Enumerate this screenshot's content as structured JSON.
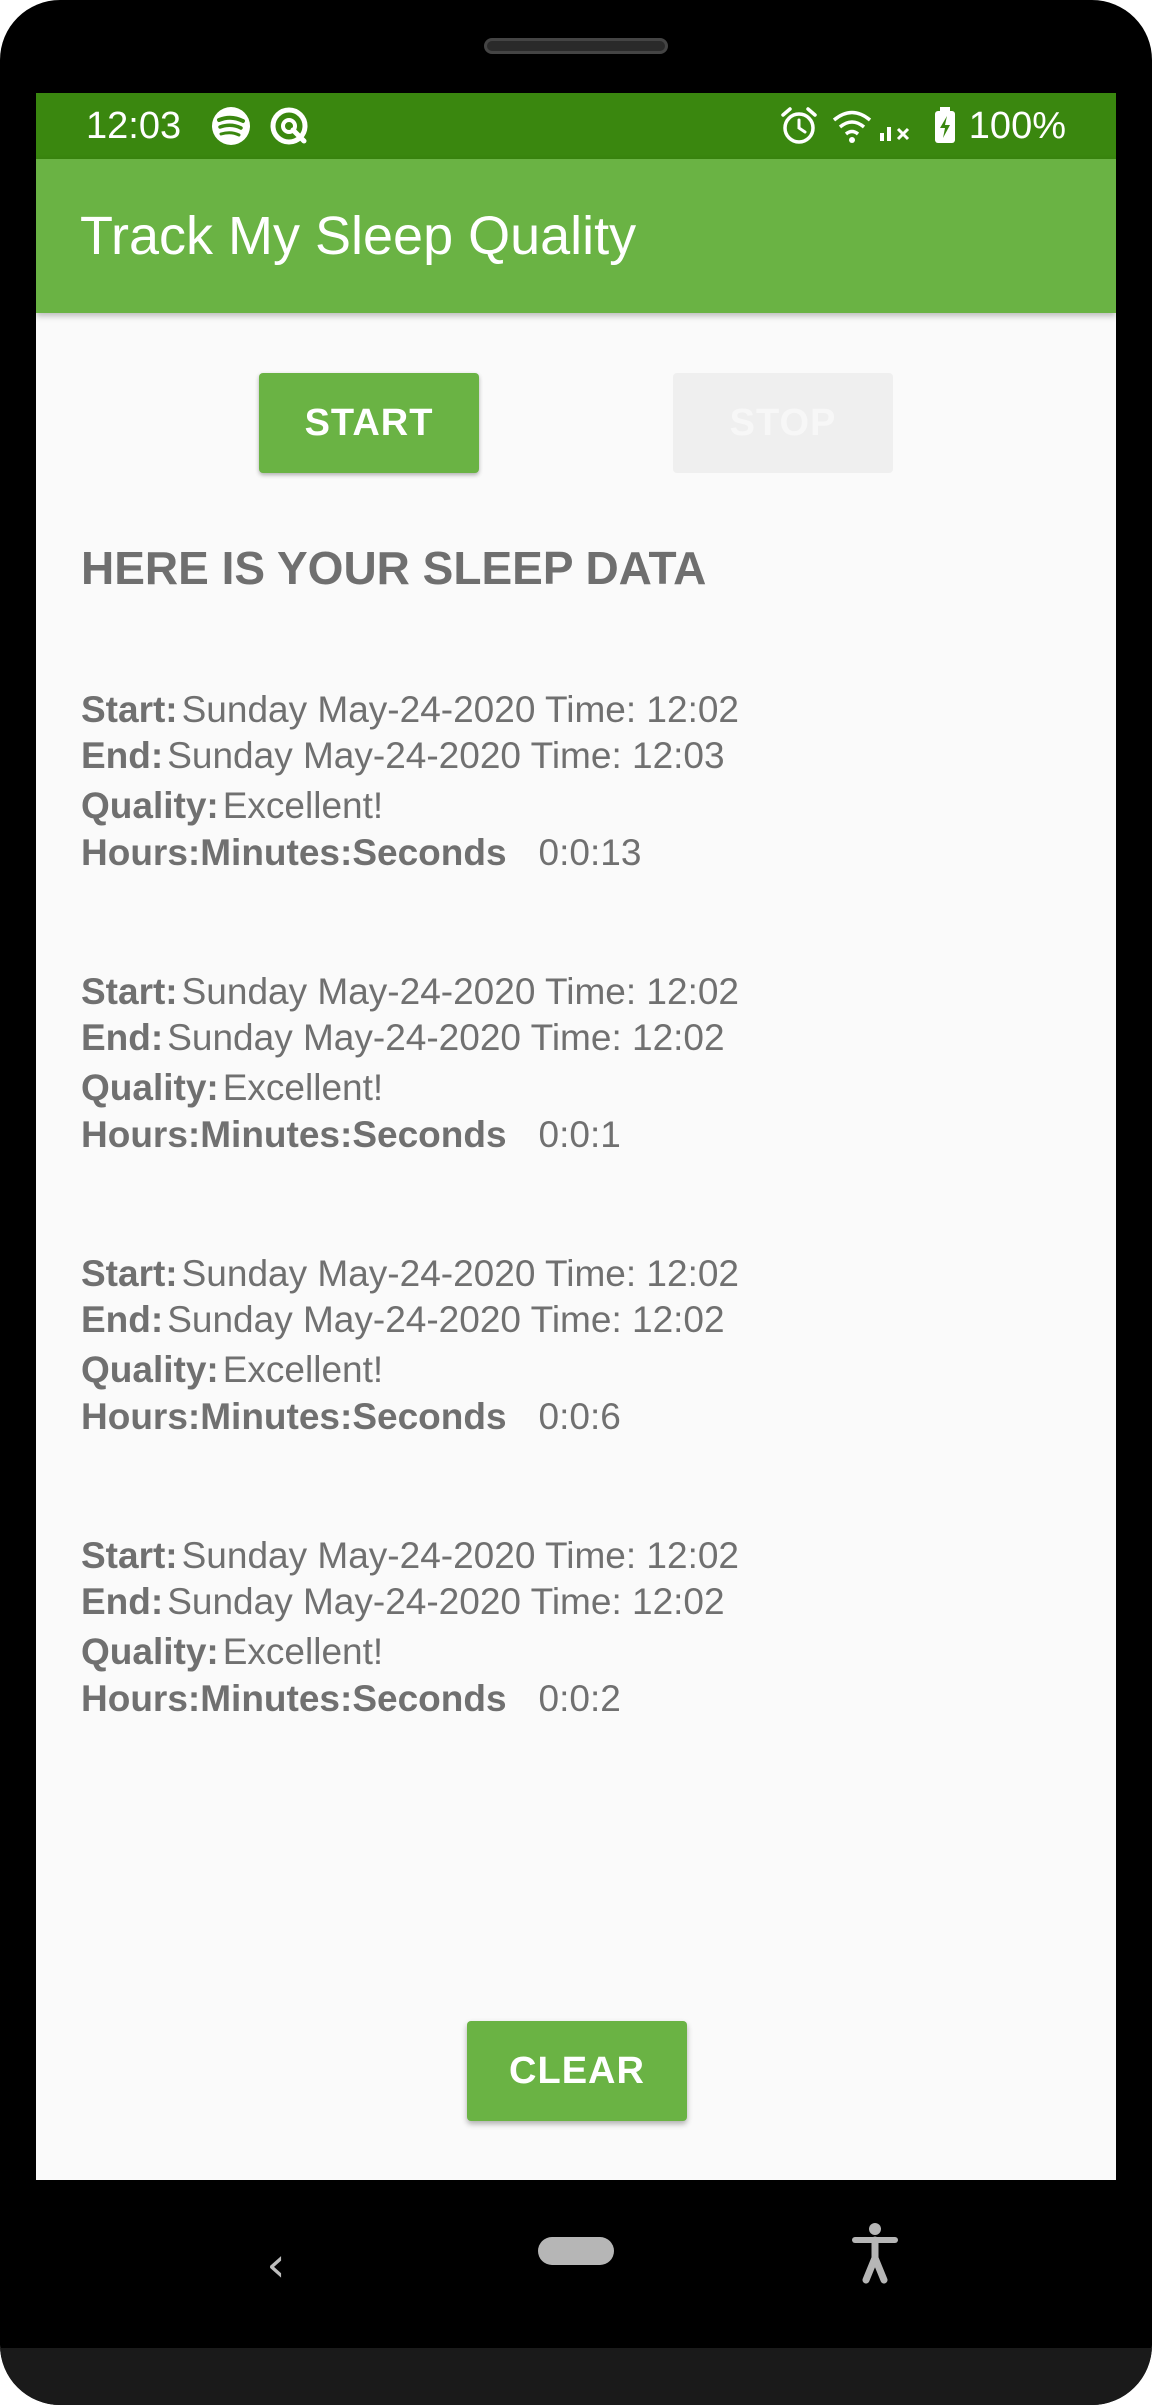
{
  "status_bar": {
    "time": "12:03",
    "left_icons": [
      "spotify-icon",
      "sync-app-icon"
    ],
    "right_icons": [
      "alarm-icon",
      "wifi-icon",
      "signal-no-data-icon",
      "battery-charging-icon"
    ],
    "battery": "100%"
  },
  "app_bar": {
    "title": "Track My Sleep Quality"
  },
  "buttons": {
    "start": "START",
    "stop": "STOP",
    "clear": "CLEAR"
  },
  "section_title": "HERE IS YOUR SLEEP DATA",
  "labels": {
    "start": "Start:",
    "end": "End:",
    "quality": "Quality:",
    "duration": "Hours:Minutes:Seconds"
  },
  "records": [
    {
      "start": "Sunday May-24-2020 Time: 12:02",
      "end": "Sunday May-24-2020 Time: 12:03",
      "quality": "Excellent!",
      "duration": "0:0:13"
    },
    {
      "start": "Sunday May-24-2020 Time: 12:02",
      "end": "Sunday May-24-2020 Time: 12:02",
      "quality": "Excellent!",
      "duration": "0:0:1"
    },
    {
      "start": "Sunday May-24-2020 Time: 12:02",
      "end": "Sunday May-24-2020 Time: 12:02",
      "quality": "Excellent!",
      "duration": "0:0:6"
    },
    {
      "start": "Sunday May-24-2020 Time: 12:02",
      "end": "Sunday May-24-2020 Time: 12:02",
      "quality": "Excellent!",
      "duration": "0:0:2"
    }
  ],
  "nav_bar": {
    "icons": [
      "back-icon",
      "home-pill-icon",
      "accessibility-icon"
    ]
  },
  "colors": {
    "status_bar": "#3a870f",
    "app_bar": "#6ab344",
    "accent": "#6ab344",
    "text": "#707070"
  }
}
